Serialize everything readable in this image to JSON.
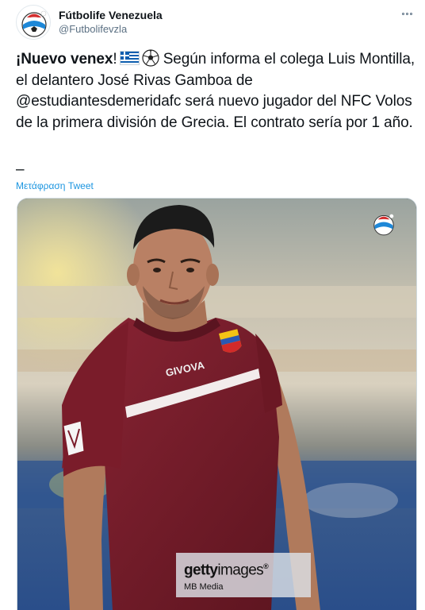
{
  "tweet": {
    "display_name": "Fútbolife Venezuela",
    "handle": "@Futbolifevzla",
    "body": {
      "bold_lead": "¡Nuevo venex",
      "after_bold": "!",
      "flag_icon": "greece-flag-icon",
      "ball_icon": "soccer-ball-icon",
      "text": " Según informa el colega Luis Montilla, el delantero José Rivas Gamboa de @estudiantesdemeridafc será nuevo jugador del NFC Volos de la primera división de Grecia. El contrato sería por 1 año."
    },
    "separator": "–",
    "translate_label": "Μετάφραση Tweet"
  },
  "media": {
    "watermark_brand_bold": "getty",
    "watermark_brand_light": "images",
    "watermark_mark": "®",
    "watermark_credit": "MB Media",
    "jersey_brand": "GIVOVA"
  },
  "colors": {
    "link": "#1b95e0",
    "secondary_text": "#5b7083",
    "jersey": "#7a1c2a",
    "greek_blue": "#0d5eaf"
  }
}
